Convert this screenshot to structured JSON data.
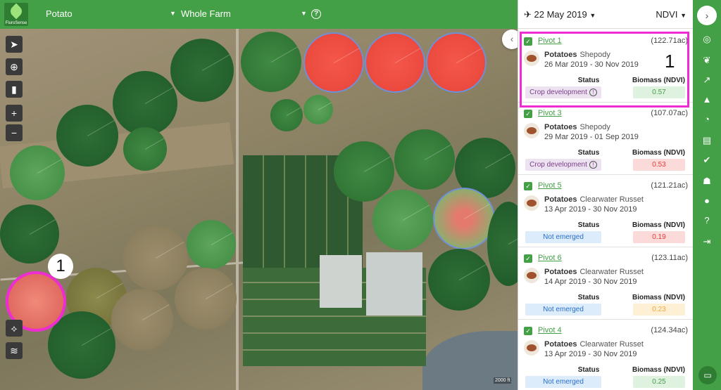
{
  "app": {
    "brand": "FluroSense"
  },
  "topbar": {
    "crop_select": "Potato",
    "farm_select": "Whole Farm",
    "help_icon": "question-circle-icon"
  },
  "panel": {
    "date": "22 May 2019",
    "layer": "NDVI",
    "cards": [
      {
        "name": "Pivot 1",
        "area": "(122.71ac)",
        "crop": "Potatoes",
        "variety": "Shepody",
        "dates": "26 Mar 2019 - 30 Nov 2019",
        "status_label": "Status",
        "status": "Crop development",
        "biomass_label": "Biomass (NDVI)",
        "ndvi": "0.57",
        "status_color": "#ede3f0",
        "ndvi_color": "#dff2e0"
      },
      {
        "name": "Pivot 3",
        "area": "(107.07ac)",
        "crop": "Potatoes",
        "variety": "Shepody",
        "dates": "29 Mar 2019 - 01 Sep 2019",
        "status_label": "Status",
        "status": "Crop development",
        "biomass_label": "Biomass (NDVI)",
        "ndvi": "0.53",
        "status_color": "#ede3f0",
        "ndvi_color": "#fbdada"
      },
      {
        "name": "Pivot 5",
        "area": "(121.21ac)",
        "crop": "Potatoes",
        "variety": "Clearwater Russet",
        "dates": "13 Apr 2019 - 30 Nov 2019",
        "status_label": "Status",
        "status": "Not emerged",
        "biomass_label": "Biomass (NDVI)",
        "ndvi": "0.19",
        "status_color": "#dcecfb",
        "ndvi_color": "#fbdada"
      },
      {
        "name": "Pivot 6",
        "area": "(123.11ac)",
        "crop": "Potatoes",
        "variety": "Clearwater Russet",
        "dates": "14 Apr 2019 - 30 Nov 2019",
        "status_label": "Status",
        "status": "Not emerged",
        "biomass_label": "Biomass (NDVI)",
        "ndvi": "0.23",
        "status_color": "#dcecfb",
        "ndvi_color": "#fdf0d4"
      },
      {
        "name": "Pivot 4",
        "area": "(124.34ac)",
        "crop": "Potatoes",
        "variety": "Clearwater Russet",
        "dates": "13 Apr 2019 - 30 Nov 2019",
        "status_label": "Status",
        "status": "Not emerged",
        "biomass_label": "Biomass (NDVI)",
        "ndvi": "0.25",
        "status_color": "#dcecfb",
        "ndvi_color": "#dff2e0"
      }
    ]
  },
  "map": {
    "scale": "2000 ft",
    "callout_map": "1",
    "callout_panel": "1"
  },
  "colors": {
    "brand_green": "#44a047",
    "highlight": "#ef2bd2"
  }
}
